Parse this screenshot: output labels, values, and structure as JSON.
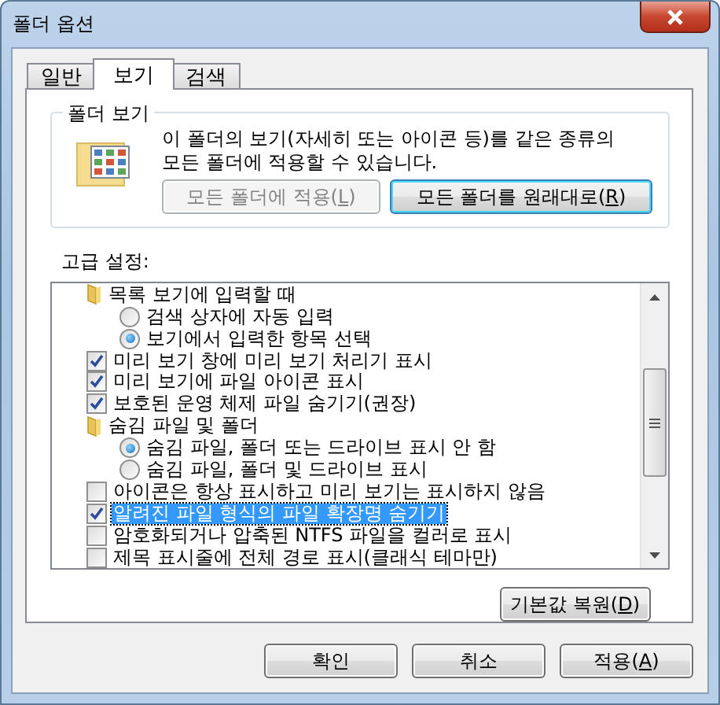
{
  "window": {
    "title": "폴더 옵션"
  },
  "tabs": [
    {
      "label": "일반",
      "selected": false
    },
    {
      "label": "보기",
      "selected": true
    },
    {
      "label": "검색",
      "selected": false
    }
  ],
  "folder_views": {
    "title": "폴더 보기",
    "description": "이 폴더의 보기(자세히 또는 아이콘 등)를 같은 종류의 모든 폴더에 적용할 수 있습니다.",
    "buttons": [
      {
        "label": "모든 폴더에 적용(",
        "access_key": "L",
        "label_end": ")",
        "disabled": true,
        "default": false
      },
      {
        "label": "모든 폴더를 원래대로(",
        "access_key": "R",
        "label_end": ")",
        "disabled": false,
        "default": true
      }
    ]
  },
  "advanced": {
    "title": "고급 설정:",
    "items": [
      {
        "kind": "folder",
        "label": "목록 보기에 입력할 때",
        "children": [
          {
            "kind": "radio",
            "label": "검색 상자에 자동 입력",
            "selected": false
          },
          {
            "kind": "radio",
            "label": "보기에서 입력한 항목 선택",
            "selected": true
          }
        ]
      },
      {
        "kind": "checkbox",
        "label": "미리 보기 창에 미리 보기 처리기 표시",
        "checked": true,
        "selected": false
      },
      {
        "kind": "checkbox",
        "label": "미리 보기에 파일 아이콘 표시",
        "checked": true,
        "selected": false
      },
      {
        "kind": "checkbox",
        "label": "보호된 운영 체제 파일 숨기기(권장)",
        "checked": true,
        "selected": false
      },
      {
        "kind": "folder",
        "label": "숨김 파일 및 폴더",
        "children": [
          {
            "kind": "radio",
            "label": "숨김 파일, 폴더 또는 드라이브 표시 안 함",
            "selected": true
          },
          {
            "kind": "radio",
            "label": "숨김 파일, 폴더 및 드라이브 표시",
            "selected": false
          }
        ]
      },
      {
        "kind": "checkbox",
        "label": "아이콘은 항상 표시하고 미리 보기는 표시하지 않음",
        "checked": false,
        "selected": false
      },
      {
        "kind": "checkbox",
        "label": "알려진 파일 형식의 파일 확장명 숨기기",
        "checked": true,
        "selected": true
      },
      {
        "kind": "checkbox",
        "label": "암호화되거나 압축된 NTFS 파일을 컬러로 표시",
        "checked": false,
        "selected": false
      },
      {
        "kind": "checkbox",
        "label": "제목 표시줄에 전체 경로 표시(클래식 테마만)",
        "checked": false,
        "selected": false
      }
    ],
    "restore_button": {
      "label": "기본값 복원(",
      "access_key": "D",
      "label_end": ")"
    }
  },
  "buttons": [
    {
      "label": "확인"
    },
    {
      "label": "취소"
    },
    {
      "label": "적용(",
      "access_key": "A",
      "label_end": ")"
    }
  ]
}
